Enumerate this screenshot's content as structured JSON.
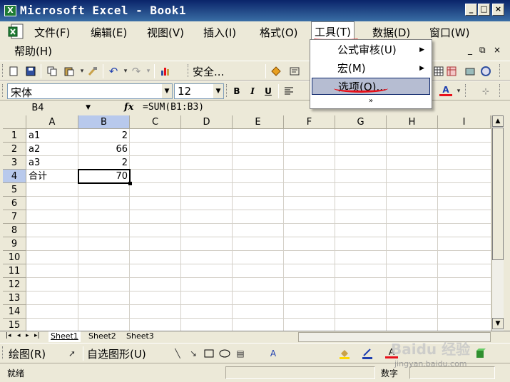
{
  "app": {
    "title": "Microsoft Excel - Book1",
    "icon_glyph": "X"
  },
  "window_buttons": {
    "minimize": "_",
    "maximize": "□",
    "close": "×"
  },
  "menubar": {
    "items": [
      {
        "label": "文件(F)"
      },
      {
        "label": "编辑(E)"
      },
      {
        "label": "视图(V)"
      },
      {
        "label": "插入(I)"
      },
      {
        "label": "格式(O)"
      },
      {
        "label": "工具(T)"
      },
      {
        "label": "数据(D)"
      },
      {
        "label": "窗口(W)"
      },
      {
        "label": "帮助(H)"
      }
    ],
    "mdi_buttons": {
      "minimize": "_",
      "restore": "⧉",
      "close": "×"
    }
  },
  "toolbar_standard": {
    "security_label": "安全...",
    "icons": [
      "new-icon",
      "open-icon",
      "save-icon",
      "copy-icon",
      "paste-icon",
      "format-painter-icon",
      "undo-icon",
      "redo-icon",
      "chart-icon",
      "security-icon",
      "drawing-icon"
    ]
  },
  "toolbar_format": {
    "font_name": "宋体",
    "font_size": "12",
    "bold": "B",
    "italic": "I",
    "underline": "U",
    "font_color_glyph": "A"
  },
  "formula_bar": {
    "name_box": "B4",
    "fx": "fx",
    "formula": "=SUM(B1:B3)"
  },
  "columns": [
    "A",
    "B",
    "C",
    "D",
    "E",
    "F",
    "G",
    "H",
    "I"
  ],
  "rows": [
    "1",
    "2",
    "3",
    "4",
    "5",
    "6",
    "7",
    "8",
    "9",
    "10",
    "11",
    "12",
    "13",
    "14",
    "15"
  ],
  "cells": {
    "A1": "a1",
    "B1": "2",
    "A2": "a2",
    "B2": "66",
    "A3": "a3",
    "B3": "2",
    "A4": "合计",
    "B4": "70"
  },
  "active_cell": "B4",
  "tools_menu": {
    "items": [
      {
        "label": "公式审核(U)",
        "has_submenu": true
      },
      {
        "label": "宏(M)",
        "has_submenu": true
      },
      {
        "label": "选项(O)...",
        "has_submenu": false,
        "highlighted": true
      }
    ],
    "more_glyph": "»"
  },
  "sheet_tabs": [
    "Sheet1",
    "Sheet2",
    "Sheet3"
  ],
  "active_sheet": "Sheet1",
  "drawing_toolbar": {
    "draw_label": "绘图(R)",
    "autoshapes_label": "自选图形(U)"
  },
  "statusbar": {
    "left": "就绪",
    "mode": "数字"
  },
  "watermark": {
    "text": "Baidu 经验",
    "url": "jingyan.baidu.com"
  },
  "colors": {
    "title_bar": "#0A246A",
    "selected_header": "#B8C9EC",
    "menu_highlight": "#B6BDD2",
    "annotation_red": "#E8101A"
  }
}
